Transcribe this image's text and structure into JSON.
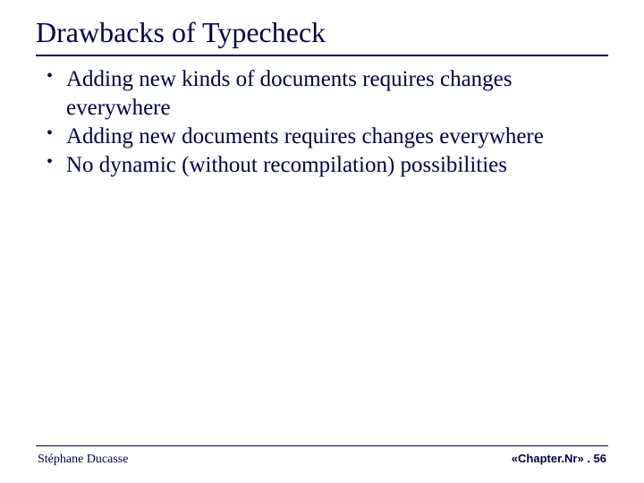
{
  "title": "Drawbacks of Typecheck",
  "bullets": [
    "Adding new kinds of documents requires changes everywhere",
    "Adding new documents requires changes everywhere",
    "No dynamic (without recompilation) possibilities"
  ],
  "footer": {
    "author": "Stéphane Ducasse",
    "page_ref": "«Chapter.Nr» . 56"
  }
}
